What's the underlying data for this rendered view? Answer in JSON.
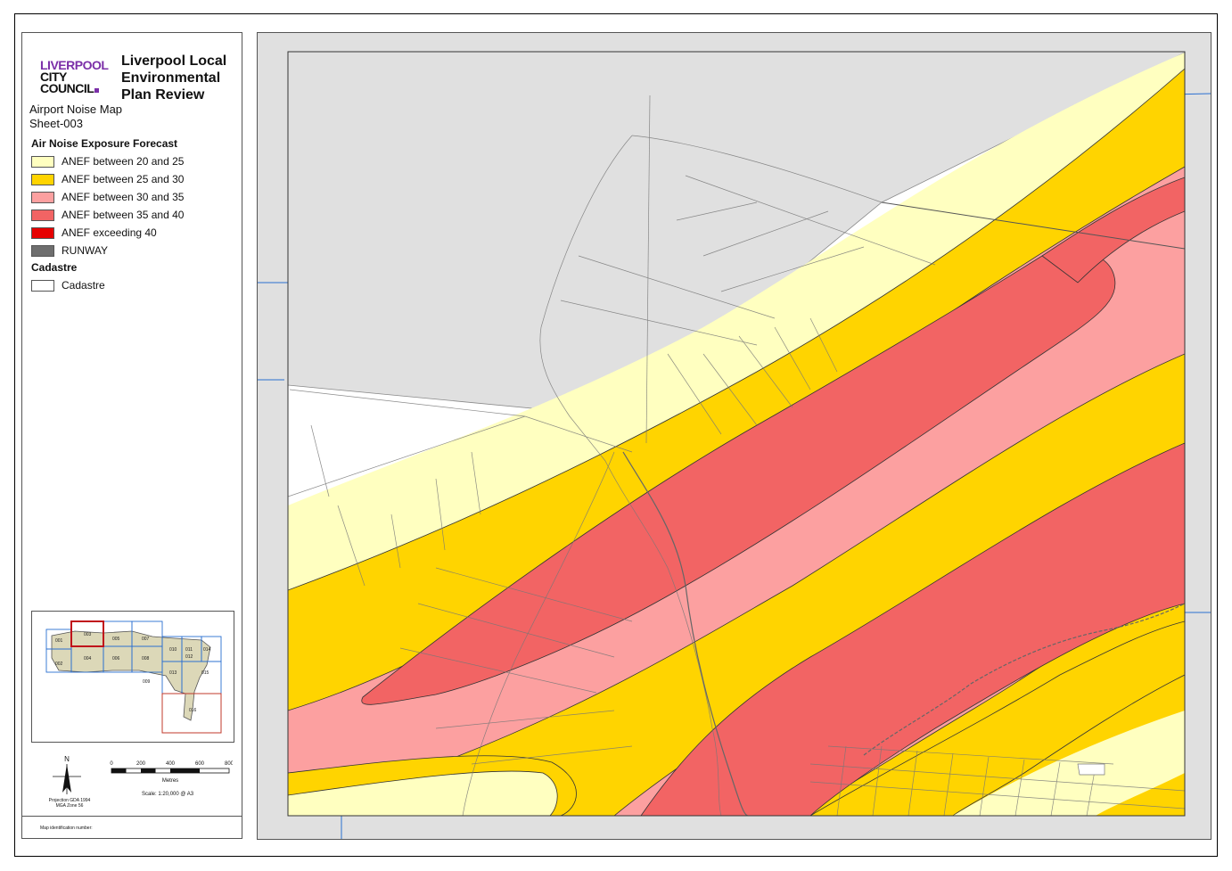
{
  "logo": {
    "line1": "LIVERPOOL",
    "line2": "CITY",
    "line3": "COUNCIL"
  },
  "title": "Liverpool Local Environmental Plan Review",
  "subtitle": {
    "line1": "Airport Noise Map",
    "line2": "Sheet-003"
  },
  "legend": {
    "section1": "Air Noise Exposure Forecast",
    "items": [
      {
        "label": "ANEF between 20 and 25",
        "color": "#ffffc0"
      },
      {
        "label": "ANEF between 25 and 30",
        "color": "#ffd400"
      },
      {
        "label": "ANEF between 30 and 35",
        "color": "#fca0a0"
      },
      {
        "label": "ANEF between 35 and 40",
        "color": "#f26464"
      },
      {
        "label": "ANEF exceeding 40",
        "color": "#e60000"
      },
      {
        "label": "RUNWAY",
        "color": "#6e6e6e"
      }
    ],
    "section2": "Cadastre",
    "cadastre": {
      "label": "Cadastre",
      "color": "#ffffff"
    }
  },
  "inset": {
    "sheets": [
      "001",
      "002",
      "003",
      "004",
      "005",
      "006",
      "007",
      "008",
      "009",
      "010",
      "011",
      "012",
      "013",
      "014",
      "015",
      "016"
    ],
    "current": "003"
  },
  "scale": {
    "ticks": [
      "0",
      "200",
      "400",
      "600",
      "800"
    ],
    "unit": "Metres",
    "text": "Scale: 1:20,000 @ A3"
  },
  "projection": {
    "line1": "Projection GDA 1994",
    "line2": "MGA Zone 56"
  },
  "north": "N",
  "map_id_label": "Map identification number:"
}
